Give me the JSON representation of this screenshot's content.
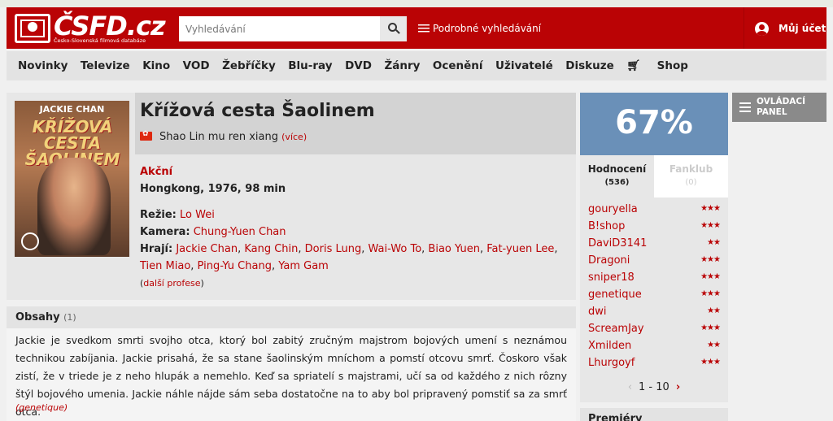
{
  "header": {
    "logo_text": "ČSFD.cz",
    "logo_subtitle": "Česko-Slovenská filmová databáze",
    "search_placeholder": "Vyhledávání",
    "advanced_search": "Podrobné vyhledávání",
    "account": "Můj účet"
  },
  "nav": {
    "items": [
      "Novinky",
      "Televize",
      "Kino",
      "VOD",
      "Žebříčky",
      "Blu-ray",
      "DVD",
      "Žánry",
      "Ocenění",
      "Uživatelé",
      "Diskuze",
      "Shop"
    ]
  },
  "movie": {
    "poster_actor": "JACKIE CHAN",
    "poster_title": "KŘÍŽOVÁ CESTA ŠAOLINEM",
    "title": "Křížová cesta Šaolinem",
    "original_title": "Shao Lin mu ren xiang",
    "more": "(více)",
    "genre": "Akční",
    "info": "Hongkong, 1976, 98 min",
    "director_label": "Režie:",
    "director": "Lo Wei",
    "camera_label": "Kamera:",
    "camera": "Chung-Yuen Chan",
    "cast_label": "Hrají:",
    "cast": [
      "Jackie Chan",
      "Kang Chin",
      "Doris Lung",
      "Wai-Wo To",
      "Biao Yuen",
      "Fat-yuen Lee",
      "Tien Miao",
      "Ping-Yu Chang",
      "Yam Gam"
    ],
    "more_professions": "další profese"
  },
  "plot": {
    "heading": "Obsahy",
    "count": "(1)",
    "text": "Jackie je svedkom smrti svojho otca, ktorý bol zabitý zručným majstrom bojových umení s neznámou technikou zabíjania. Jackie prisahá, že sa stane šaolinským mníchom a pomstí otcovu smrť. Čoskoro však zistí, že v triede je z neho hlupák a nemehlo. Keď sa spriatelí s majstrami, učí sa od každého z nich rôzny štýl bojového umenia. Jackie náhle nájde sám seba dostatočne na to aby bol pripravený pomstiť sa za smrť otca.",
    "author": "(genetique)"
  },
  "rating": {
    "percent": "67%",
    "tab_ratings": "Hodnocení",
    "tab_ratings_count": "(536)",
    "tab_fanclub": "Fanklub",
    "tab_fanclub_count": "(0)",
    "users": [
      {
        "name": "gouryella",
        "stars": 3
      },
      {
        "name": "B!shop",
        "stars": 3
      },
      {
        "name": "DaviD3141",
        "stars": 2
      },
      {
        "name": "Dragoni",
        "stars": 3
      },
      {
        "name": "sniper18",
        "stars": 3
      },
      {
        "name": "genetique",
        "stars": 3
      },
      {
        "name": "dwi",
        "stars": 2
      },
      {
        "name": "ScreamJay",
        "stars": 3
      },
      {
        "name": "Xmilden",
        "stars": 2
      },
      {
        "name": "Lhurgoyf",
        "stars": 3
      }
    ],
    "pager": "1 - 10"
  },
  "sidebar": {
    "panel_button": "OVLÁDACÍ PANEL",
    "premieres": "Premiéry"
  },
  "colors": {
    "brand_red": "#ba0305",
    "rating_blue": "#6a90b8"
  }
}
